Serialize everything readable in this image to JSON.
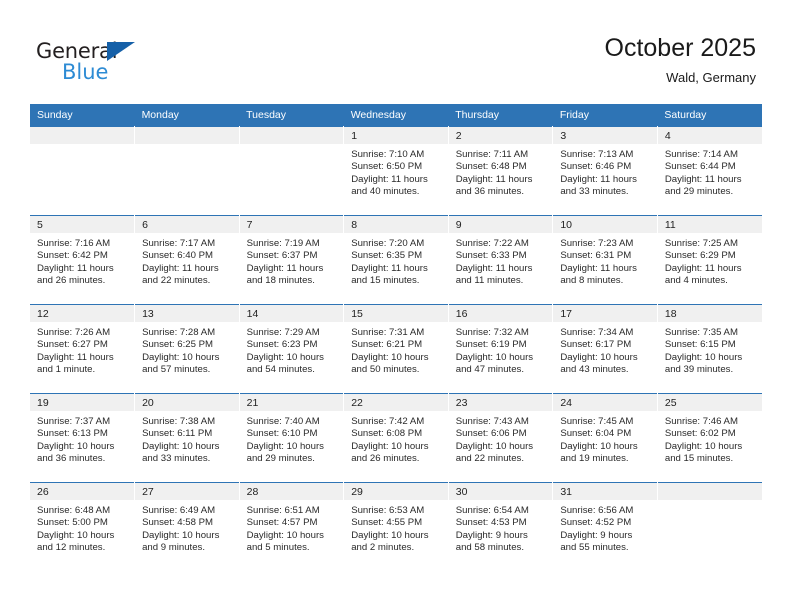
{
  "brand": {
    "name_top": "General",
    "name_bottom": "Blue",
    "triangle_color": "#1560a8",
    "blue_color": "#2d8bd4",
    "dark_color": "#231f20",
    "logo_icon": "triangle-flag-icon"
  },
  "header": {
    "title": "October 2025",
    "subtitle": "Wald, Germany",
    "accent_color": "#2e74b5",
    "band_color": "#f0f0f0"
  },
  "weekday_headers": [
    "Sunday",
    "Monday",
    "Tuesday",
    "Wednesday",
    "Thursday",
    "Friday",
    "Saturday"
  ],
  "labels": {
    "sunrise_prefix": "Sunrise:",
    "sunset_prefix": "Sunset:",
    "daylight_prefix": "Daylight:"
  },
  "weeks": [
    [
      {
        "empty": true
      },
      {
        "empty": true
      },
      {
        "empty": true
      },
      {
        "day": "1",
        "sunrise": "Sunrise: 7:10 AM",
        "sunset": "Sunset: 6:50 PM",
        "daylight": "Daylight: 11 hours and 40 minutes."
      },
      {
        "day": "2",
        "sunrise": "Sunrise: 7:11 AM",
        "sunset": "Sunset: 6:48 PM",
        "daylight": "Daylight: 11 hours and 36 minutes."
      },
      {
        "day": "3",
        "sunrise": "Sunrise: 7:13 AM",
        "sunset": "Sunset: 6:46 PM",
        "daylight": "Daylight: 11 hours and 33 minutes."
      },
      {
        "day": "4",
        "sunrise": "Sunrise: 7:14 AM",
        "sunset": "Sunset: 6:44 PM",
        "daylight": "Daylight: 11 hours and 29 minutes."
      }
    ],
    [
      {
        "day": "5",
        "sunrise": "Sunrise: 7:16 AM",
        "sunset": "Sunset: 6:42 PM",
        "daylight": "Daylight: 11 hours and 26 minutes."
      },
      {
        "day": "6",
        "sunrise": "Sunrise: 7:17 AM",
        "sunset": "Sunset: 6:40 PM",
        "daylight": "Daylight: 11 hours and 22 minutes."
      },
      {
        "day": "7",
        "sunrise": "Sunrise: 7:19 AM",
        "sunset": "Sunset: 6:37 PM",
        "daylight": "Daylight: 11 hours and 18 minutes."
      },
      {
        "day": "8",
        "sunrise": "Sunrise: 7:20 AM",
        "sunset": "Sunset: 6:35 PM",
        "daylight": "Daylight: 11 hours and 15 minutes."
      },
      {
        "day": "9",
        "sunrise": "Sunrise: 7:22 AM",
        "sunset": "Sunset: 6:33 PM",
        "daylight": "Daylight: 11 hours and 11 minutes."
      },
      {
        "day": "10",
        "sunrise": "Sunrise: 7:23 AM",
        "sunset": "Sunset: 6:31 PM",
        "daylight": "Daylight: 11 hours and 8 minutes."
      },
      {
        "day": "11",
        "sunrise": "Sunrise: 7:25 AM",
        "sunset": "Sunset: 6:29 PM",
        "daylight": "Daylight: 11 hours and 4 minutes."
      }
    ],
    [
      {
        "day": "12",
        "sunrise": "Sunrise: 7:26 AM",
        "sunset": "Sunset: 6:27 PM",
        "daylight": "Daylight: 11 hours and 1 minute."
      },
      {
        "day": "13",
        "sunrise": "Sunrise: 7:28 AM",
        "sunset": "Sunset: 6:25 PM",
        "daylight": "Daylight: 10 hours and 57 minutes."
      },
      {
        "day": "14",
        "sunrise": "Sunrise: 7:29 AM",
        "sunset": "Sunset: 6:23 PM",
        "daylight": "Daylight: 10 hours and 54 minutes."
      },
      {
        "day": "15",
        "sunrise": "Sunrise: 7:31 AM",
        "sunset": "Sunset: 6:21 PM",
        "daylight": "Daylight: 10 hours and 50 minutes."
      },
      {
        "day": "16",
        "sunrise": "Sunrise: 7:32 AM",
        "sunset": "Sunset: 6:19 PM",
        "daylight": "Daylight: 10 hours and 47 minutes."
      },
      {
        "day": "17",
        "sunrise": "Sunrise: 7:34 AM",
        "sunset": "Sunset: 6:17 PM",
        "daylight": "Daylight: 10 hours and 43 minutes."
      },
      {
        "day": "18",
        "sunrise": "Sunrise: 7:35 AM",
        "sunset": "Sunset: 6:15 PM",
        "daylight": "Daylight: 10 hours and 39 minutes."
      }
    ],
    [
      {
        "day": "19",
        "sunrise": "Sunrise: 7:37 AM",
        "sunset": "Sunset: 6:13 PM",
        "daylight": "Daylight: 10 hours and 36 minutes."
      },
      {
        "day": "20",
        "sunrise": "Sunrise: 7:38 AM",
        "sunset": "Sunset: 6:11 PM",
        "daylight": "Daylight: 10 hours and 33 minutes."
      },
      {
        "day": "21",
        "sunrise": "Sunrise: 7:40 AM",
        "sunset": "Sunset: 6:10 PM",
        "daylight": "Daylight: 10 hours and 29 minutes."
      },
      {
        "day": "22",
        "sunrise": "Sunrise: 7:42 AM",
        "sunset": "Sunset: 6:08 PM",
        "daylight": "Daylight: 10 hours and 26 minutes."
      },
      {
        "day": "23",
        "sunrise": "Sunrise: 7:43 AM",
        "sunset": "Sunset: 6:06 PM",
        "daylight": "Daylight: 10 hours and 22 minutes."
      },
      {
        "day": "24",
        "sunrise": "Sunrise: 7:45 AM",
        "sunset": "Sunset: 6:04 PM",
        "daylight": "Daylight: 10 hours and 19 minutes."
      },
      {
        "day": "25",
        "sunrise": "Sunrise: 7:46 AM",
        "sunset": "Sunset: 6:02 PM",
        "daylight": "Daylight: 10 hours and 15 minutes."
      }
    ],
    [
      {
        "day": "26",
        "sunrise": "Sunrise: 6:48 AM",
        "sunset": "Sunset: 5:00 PM",
        "daylight": "Daylight: 10 hours and 12 minutes."
      },
      {
        "day": "27",
        "sunrise": "Sunrise: 6:49 AM",
        "sunset": "Sunset: 4:58 PM",
        "daylight": "Daylight: 10 hours and 9 minutes."
      },
      {
        "day": "28",
        "sunrise": "Sunrise: 6:51 AM",
        "sunset": "Sunset: 4:57 PM",
        "daylight": "Daylight: 10 hours and 5 minutes."
      },
      {
        "day": "29",
        "sunrise": "Sunrise: 6:53 AM",
        "sunset": "Sunset: 4:55 PM",
        "daylight": "Daylight: 10 hours and 2 minutes."
      },
      {
        "day": "30",
        "sunrise": "Sunrise: 6:54 AM",
        "sunset": "Sunset: 4:53 PM",
        "daylight": "Daylight: 9 hours and 58 minutes."
      },
      {
        "day": "31",
        "sunrise": "Sunrise: 6:56 AM",
        "sunset": "Sunset: 4:52 PM",
        "daylight": "Daylight: 9 hours and 55 minutes."
      },
      {
        "empty": true
      }
    ]
  ]
}
